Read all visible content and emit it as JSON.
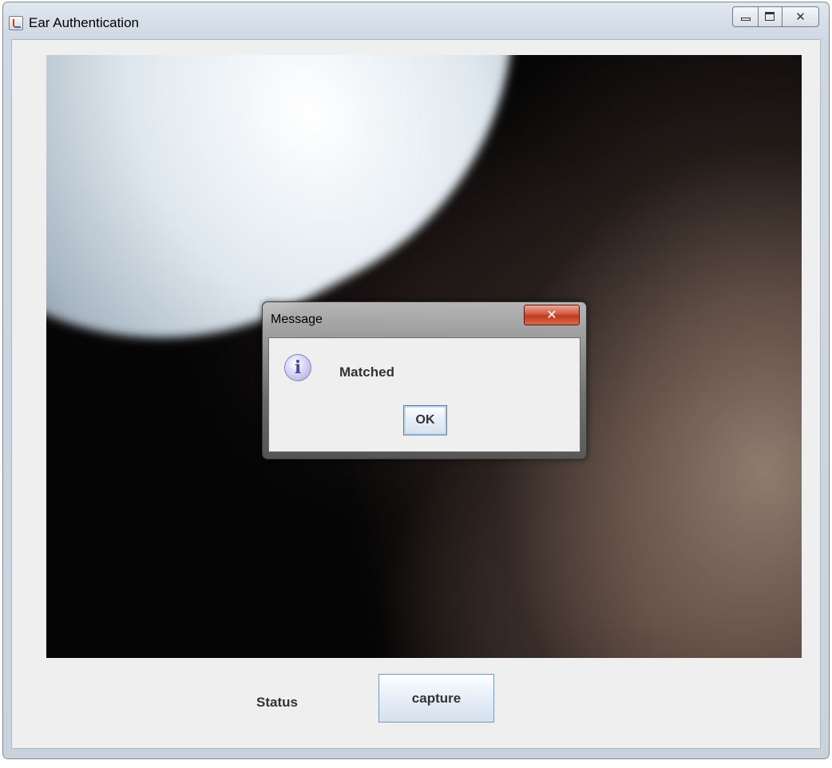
{
  "window": {
    "title": "Ear Authentication",
    "icon": "java-app-icon",
    "controls": [
      "minimize-icon",
      "maximize-icon",
      "close-icon"
    ]
  },
  "camera": {
    "icon": "camera-feed"
  },
  "bottom": {
    "status_label": "Status",
    "capture_label": "capture"
  },
  "dialog": {
    "title": "Message",
    "icon": "info-icon",
    "icon_glyph": "i",
    "message": "Matched",
    "ok_label": "OK",
    "close_color": "#c8452c"
  },
  "colors": {
    "panel_bg": "#efefef",
    "button_border": "#7a96b8",
    "frame": "#cfd9e4"
  }
}
